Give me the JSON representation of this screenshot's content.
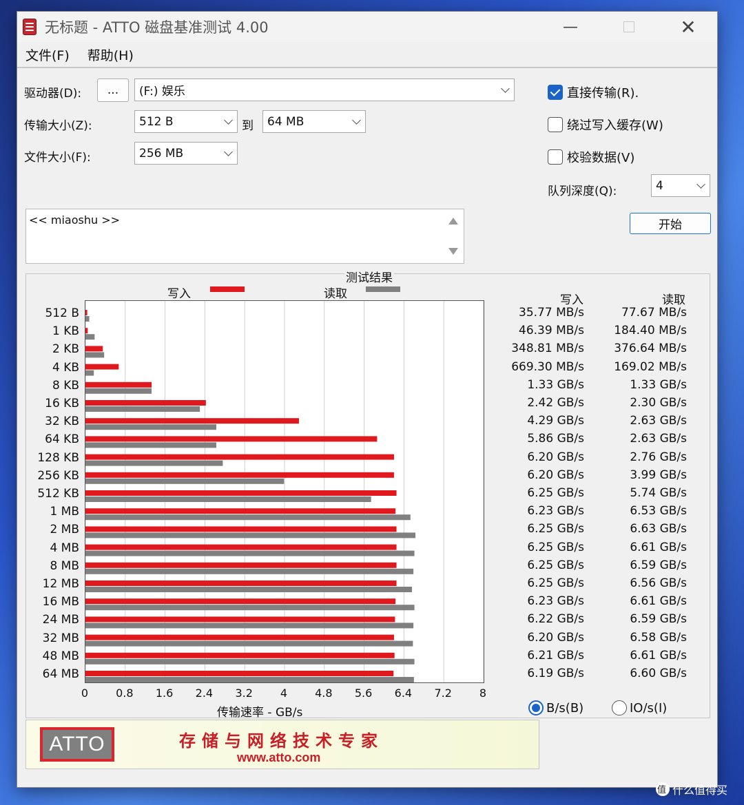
{
  "window": {
    "title": "无标题 - ATTO 磁盘基准测试 4.00",
    "minimize": "—",
    "close": "✕"
  },
  "menu": [
    "文件(F)",
    "帮助(H)"
  ],
  "form": {
    "drive_label": "驱动器(D):",
    "browse_button": "...",
    "drive_value": "(F:) 娱乐",
    "transfer_label": "传输大小(Z):",
    "transfer_from": "512 B",
    "to_label": "到",
    "transfer_to": "64 MB",
    "file_size_label": "文件大小(F):",
    "file_size_value": "256 MB",
    "direct_io_label": "直接传输(R).",
    "direct_io_checked": true,
    "bypass_cache_label": "绕过写入缓存(W)",
    "bypass_cache_checked": false,
    "verify_label": "校验数据(V)",
    "verify_checked": false,
    "queue_label": "队列深度(Q):",
    "queue_value": "4",
    "start_button": "开始",
    "description": "<< miaoshu >>"
  },
  "results": {
    "title": "测试结果",
    "legend_write": "写入",
    "legend_read": "读取",
    "col_write": "写入",
    "col_read": "读取",
    "radio_bps": "B/s(B)",
    "radio_iops": "IO/s(I)",
    "radio_bps_selected": true
  },
  "chart_data": {
    "type": "bar",
    "orientation": "horizontal",
    "xlabel": "传输速率 - GB/s",
    "xlim": [
      0,
      8
    ],
    "xticks": [
      "0",
      "0.8",
      "1.6",
      "2.4",
      "3.2",
      "4",
      "4.8",
      "5.6",
      "6.4",
      "7.2",
      "8"
    ],
    "grid": true,
    "categories": [
      "512 B",
      "1 KB",
      "2 KB",
      "4 KB",
      "8 KB",
      "16 KB",
      "32 KB",
      "64 KB",
      "128 KB",
      "256 KB",
      "512 KB",
      "1 MB",
      "2 MB",
      "4 MB",
      "8 MB",
      "12 MB",
      "16 MB",
      "24 MB",
      "32 MB",
      "48 MB",
      "64 MB"
    ],
    "series": [
      {
        "name": "写入",
        "color": "#e0191f",
        "values": [
          0.03577,
          0.04639,
          0.34881,
          0.6693,
          1.33,
          2.42,
          4.29,
          5.86,
          6.2,
          6.2,
          6.25,
          6.23,
          6.25,
          6.25,
          6.25,
          6.25,
          6.23,
          6.22,
          6.2,
          6.21,
          6.19
        ],
        "labels": [
          "35.77 MB/s",
          "46.39 MB/s",
          "348.81 MB/s",
          "669.30 MB/s",
          "1.33 GB/s",
          "2.42 GB/s",
          "4.29 GB/s",
          "5.86 GB/s",
          "6.20 GB/s",
          "6.20 GB/s",
          "6.25 GB/s",
          "6.23 GB/s",
          "6.25 GB/s",
          "6.25 GB/s",
          "6.25 GB/s",
          "6.25 GB/s",
          "6.23 GB/s",
          "6.22 GB/s",
          "6.20 GB/s",
          "6.21 GB/s",
          "6.19 GB/s"
        ]
      },
      {
        "name": "读取",
        "color": "#808080",
        "values": [
          0.07767,
          0.1844,
          0.37664,
          0.16902,
          1.33,
          2.3,
          2.63,
          2.63,
          2.76,
          3.99,
          5.74,
          6.53,
          6.63,
          6.61,
          6.59,
          6.56,
          6.61,
          6.59,
          6.58,
          6.61,
          6.6
        ],
        "labels": [
          "77.67 MB/s",
          "184.40 MB/s",
          "376.64 MB/s",
          "169.02 MB/s",
          "1.33 GB/s",
          "2.30 GB/s",
          "2.63 GB/s",
          "2.63 GB/s",
          "2.76 GB/s",
          "3.99 GB/s",
          "5.74 GB/s",
          "6.53 GB/s",
          "6.63 GB/s",
          "6.61 GB/s",
          "6.59 GB/s",
          "6.56 GB/s",
          "6.61 GB/s",
          "6.59 GB/s",
          "6.58 GB/s",
          "6.61 GB/s",
          "6.60 GB/s"
        ]
      }
    ]
  },
  "banner": {
    "logo": "ATTO",
    "slogan": "存储与网络技术专家",
    "url": "www.atto.com"
  },
  "watermark": "什么值得买"
}
